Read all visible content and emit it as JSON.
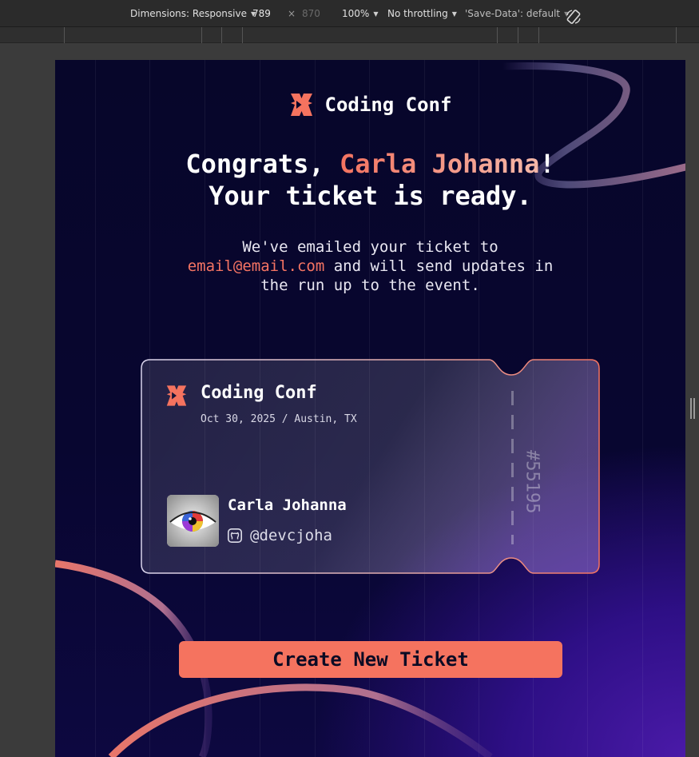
{
  "devtools": {
    "dimensions_label": "Dimensions: Responsive",
    "width": "789",
    "times": "×",
    "height": "870",
    "zoom": "100%",
    "throttling": "No throttling",
    "save_data": "'Save-Data': default",
    "icons": [
      "caret-down-icon",
      "rotate-icon"
    ]
  },
  "page": {
    "brand": "Coding Conf",
    "headline": {
      "prefix": "Congrats, ",
      "name": "Carla Johanna",
      "suffix": "!",
      "line2": "Your ticket is ready."
    },
    "subtext": {
      "line1": "We've emailed your ticket to",
      "email": "email@email.com",
      "after_email": " and will send updates in",
      "line3": "the run up to the event."
    },
    "ticket": {
      "title": "Coding Conf",
      "date_location": "Oct 30, 2025 / Austin, TX",
      "attendee_name": "Carla Johanna",
      "github_handle": "@devcjoha",
      "number": "#55195"
    },
    "cta_label": "Create New Ticket",
    "colors": {
      "accent": "#f5735f",
      "accent_light": "#f5b8a9",
      "background_dark": "#07062a",
      "background_purple": "#4a1aa8"
    },
    "icons": [
      "coding-conf-logo-icon",
      "github-icon",
      "avatar-eye-image"
    ]
  }
}
